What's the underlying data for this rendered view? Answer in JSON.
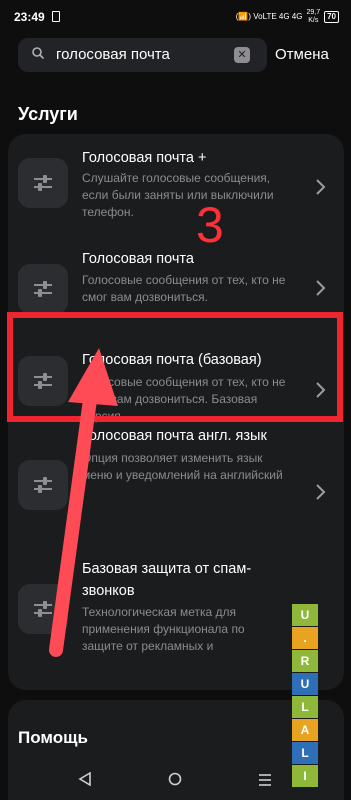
{
  "status_bar": {
    "time": "23:49",
    "network_icons": "(📶) VoLTE 4G 4G",
    "speed_value": "29,7",
    "speed_unit": "K/s",
    "battery": "70"
  },
  "search": {
    "value": "голосовая почта",
    "cancel_label": "Отмена"
  },
  "services": {
    "title": "Услуги",
    "items": [
      {
        "title": "Голосовая почта +",
        "description": "Слушайте голосовые сообщения, если были заняты или выключили телефон.",
        "icon": "sliders-icon"
      },
      {
        "title": "Голосовая почта",
        "description": "Голосовые сообщения от тех, кто не смог вам дозвониться.",
        "icon": "sliders-icon"
      },
      {
        "title": "Голосовая почта (базовая)",
        "description": "Голосовые сообщения от тех, кто не смог вам дозвониться. Базовая версия",
        "icon": "sliders-icon"
      },
      {
        "title": "Голосовая почта англ. язык",
        "description": "Опция позволяет изменить язык меню и уведомлений на английский",
        "icon": "sliders-icon"
      },
      {
        "title": "Базовая защита от спам-звонков",
        "description": "Технологическая метка для применения функционала по защите от рекламных и сомнительных",
        "icon": "sliders-icon"
      }
    ]
  },
  "help": {
    "title": "Помощь"
  },
  "annotation": {
    "step_number": "3",
    "highlight_color": "#f0252f"
  },
  "watermark": {
    "letters": [
      "U",
      ".",
      "R",
      "U",
      "L",
      "A",
      "L",
      "I",
      "N",
      "U"
    ],
    "colors": [
      "#8fb83a",
      "#e8a321",
      "#8fb83a",
      "#2e6fb8",
      "#8fb83a",
      "#e8a321",
      "#2e6fb8",
      "#8fb83a",
      "#e8a321",
      "#2e6fb8"
    ]
  },
  "nav_bar": {
    "icons": [
      "back-icon",
      "home-icon",
      "menu-icon"
    ]
  }
}
